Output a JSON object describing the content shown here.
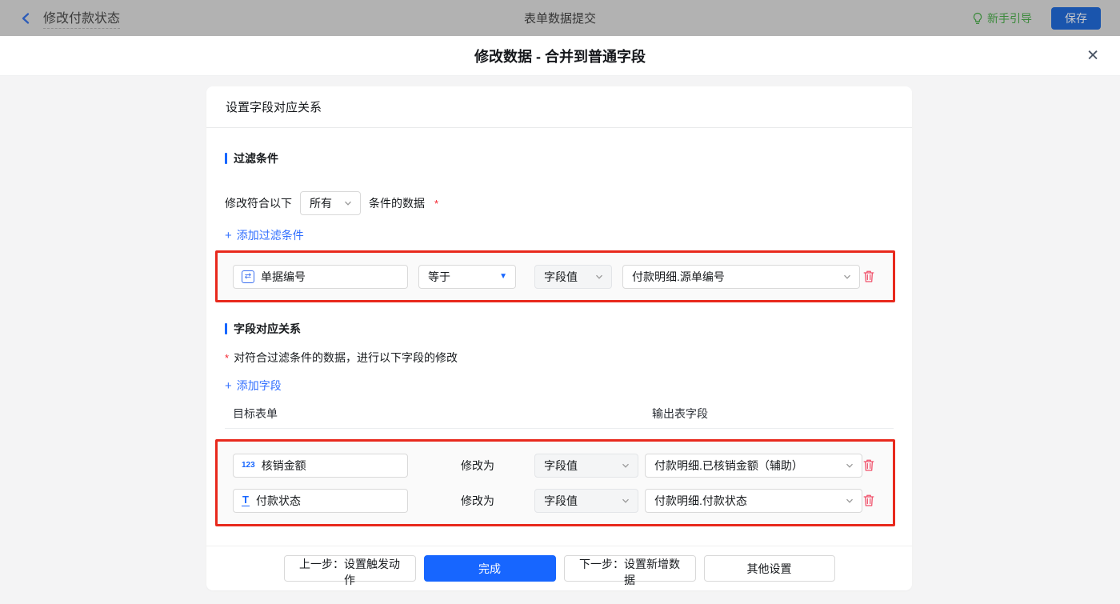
{
  "topbar": {
    "back_label": "修改付款状态",
    "center_title": "表单数据提交",
    "guide_label": "新手引导",
    "save_label": "保存"
  },
  "modal": {
    "title": "修改数据 - 合并到普通字段"
  },
  "panel": {
    "header": "设置字段对应关系",
    "filter_section": {
      "title": "过滤条件",
      "sentence_prefix": "修改符合以下",
      "match_mode": "所有",
      "sentence_suffix": "条件的数据",
      "required_mark": "*",
      "add_link": "添加过滤条件",
      "condition": {
        "field": "单据编号",
        "operator": "等于",
        "value_type": "字段值",
        "value": "付款明细.源单编号"
      }
    },
    "mapping_section": {
      "title": "字段对应关系",
      "desc_mark": "*",
      "description": "对符合过滤条件的数据，进行以下字段的修改",
      "add_link": "添加字段",
      "columns": {
        "target": "目标表单",
        "output": "输出表字段"
      },
      "rows": [
        {
          "icon": "123",
          "field": "核销金额",
          "action": "修改为",
          "value_type": "字段值",
          "value": "付款明细.已核销金额（辅助）"
        },
        {
          "icon": "T",
          "field": "付款状态",
          "action": "修改为",
          "value_type": "字段值",
          "value": "付款明细.付款状态"
        }
      ]
    },
    "footer": {
      "prev": "上一步：设置触发动作",
      "done": "完成",
      "next": "下一步：设置新增数据",
      "other": "其他设置"
    }
  },
  "icons": {
    "plus": "+",
    "close": "✕",
    "caret_down": "▼",
    "num_field": "123",
    "text_field": "T",
    "serial_field": "⇄"
  },
  "colors": {
    "accent_blue": "#1766ff",
    "highlight_red": "#e8291d",
    "trash_red": "#f0506a",
    "guide_green": "#3c8a3c",
    "required_red": "#f5222d",
    "body_gray": "#f4f4f5"
  }
}
